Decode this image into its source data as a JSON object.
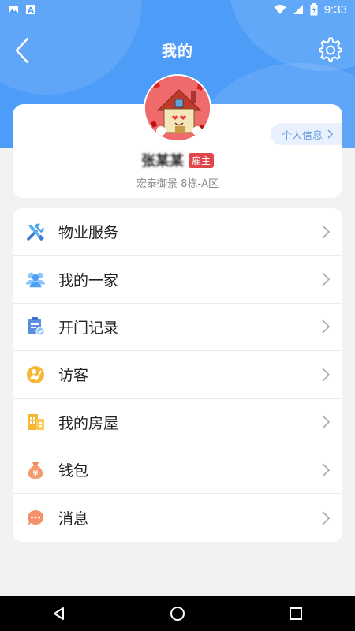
{
  "status_bar": {
    "time": "9:33"
  },
  "header": {
    "title": "我的"
  },
  "profile": {
    "name": "张某某",
    "role_badge": "雇主",
    "address": "宏泰御景 8栋-A区",
    "info_button_label": "个人信息"
  },
  "menu": {
    "items": [
      {
        "label": "物业服务",
        "icon": "tools-icon"
      },
      {
        "label": "我的一家",
        "icon": "family-icon"
      },
      {
        "label": "开门记录",
        "icon": "record-icon"
      },
      {
        "label": "访客",
        "icon": "visitor-icon"
      },
      {
        "label": "我的房屋",
        "icon": "building-icon"
      },
      {
        "label": "钱包",
        "icon": "wallet-icon"
      },
      {
        "label": "消息",
        "icon": "message-icon"
      }
    ]
  },
  "colors": {
    "header_blue": "#4d9cf8",
    "badge_red": "#e0474c",
    "info_pill_bg": "#e8f1fd",
    "info_pill_text": "#6b9fe0"
  }
}
